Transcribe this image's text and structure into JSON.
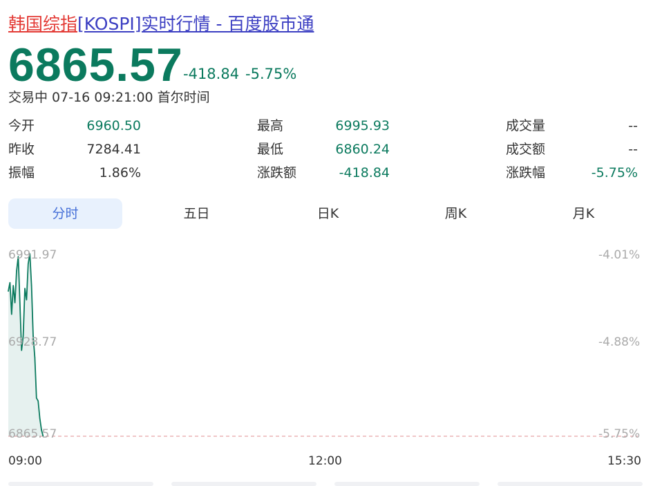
{
  "header": {
    "title_prefix": "韩国综指",
    "title_rest": "[KOSPI]实时行情 - 百度股市通"
  },
  "quote": {
    "price": "6865.57",
    "change": "-418.84",
    "change_pct": "-5.75%",
    "status": "交易中 07-16 09:21:00 首尔时间"
  },
  "stats": [
    {
      "label": "今开",
      "value": "6960.50"
    },
    {
      "label": "最高",
      "value": "6995.93"
    },
    {
      "label": "成交量",
      "value": "--"
    },
    {
      "label": "昨收",
      "value": "7284.41"
    },
    {
      "label": "最低",
      "value": "6860.24"
    },
    {
      "label": "成交额",
      "value": "--"
    },
    {
      "label": "振幅",
      "value": "1.86%"
    },
    {
      "label": "涨跌额",
      "value": "-418.84"
    },
    {
      "label": "涨跌幅",
      "value": "-5.75%"
    }
  ],
  "tabs": [
    "分时",
    "五日",
    "日K",
    "周K",
    "月K"
  ],
  "colors": {
    "down": "#0b7a5e",
    "up": "#e33a35",
    "link": "#3b3ec2",
    "tab_active_bg": "#e8f1fd",
    "tab_active_text": "#4670d8"
  },
  "chart_data": {
    "type": "line",
    "y_labels_left": [
      "6991.97",
      "6928.77",
      "6865.57"
    ],
    "y_labels_right": [
      "-4.01%",
      "-4.88%",
      "-5.75%"
    ],
    "x_ticks": [
      "09:00",
      "12:00",
      "15:30"
    ],
    "ylim": [
      6865.57,
      6991.97
    ],
    "reference_line": 6865.57,
    "series": [
      {
        "x": [
          "09:00",
          "09:01",
          "09:02",
          "09:03",
          "09:04",
          "09:05",
          "09:06",
          "09:07",
          "09:08",
          "09:09",
          "09:10",
          "09:11",
          "09:12",
          "09:13",
          "09:14",
          "09:15",
          "09:16",
          "09:17",
          "09:18",
          "09:19",
          "09:20",
          "09:21"
        ],
        "values": [
          6966.0,
          6972.0,
          6950.0,
          6970.0,
          6958.0,
          6980.0,
          6990.0,
          6958.0,
          6925.0,
          6935.0,
          6968.0,
          6960.0,
          6985.0,
          6992.0,
          6970.0,
          6935.0,
          6920.0,
          6892.0,
          6890.0,
          6878.0,
          6870.0,
          6865.57
        ]
      }
    ]
  }
}
